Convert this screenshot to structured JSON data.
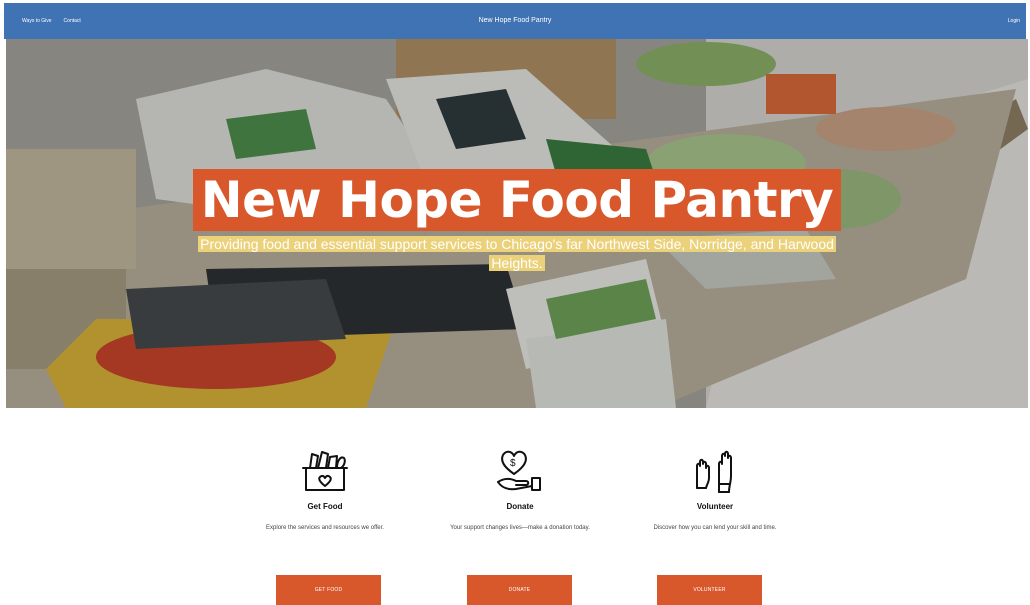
{
  "nav": {
    "items": [
      "Ways to Give",
      "Contact"
    ],
    "title": "New Hope Food Pantry",
    "login": "Login",
    "color": "#3f73b3"
  },
  "hero": {
    "title": "New Hope Food Pantry",
    "subtitle": "Providing food and essential support services to Chicago's far Northwest Side, Norridge, and Harwood Heights.",
    "title_bg": "#d8582c",
    "subtitle_bg": "#ead17a"
  },
  "features": [
    {
      "icon": "food-basket-icon",
      "title": "Get Food",
      "text": "Explore the services and resources we offer."
    },
    {
      "icon": "heart-hand-icon",
      "title": "Donate",
      "text": "Your support changes lives—make a donation today."
    },
    {
      "icon": "raised-hands-icon",
      "title": "Volunteer",
      "text": "Discover how you can lend your skill and time."
    }
  ],
  "buttons": {
    "get_food": "GET FOOD",
    "donate": "DONATE",
    "volunteer": "VOLUNTEER",
    "color": "#d8582c"
  }
}
